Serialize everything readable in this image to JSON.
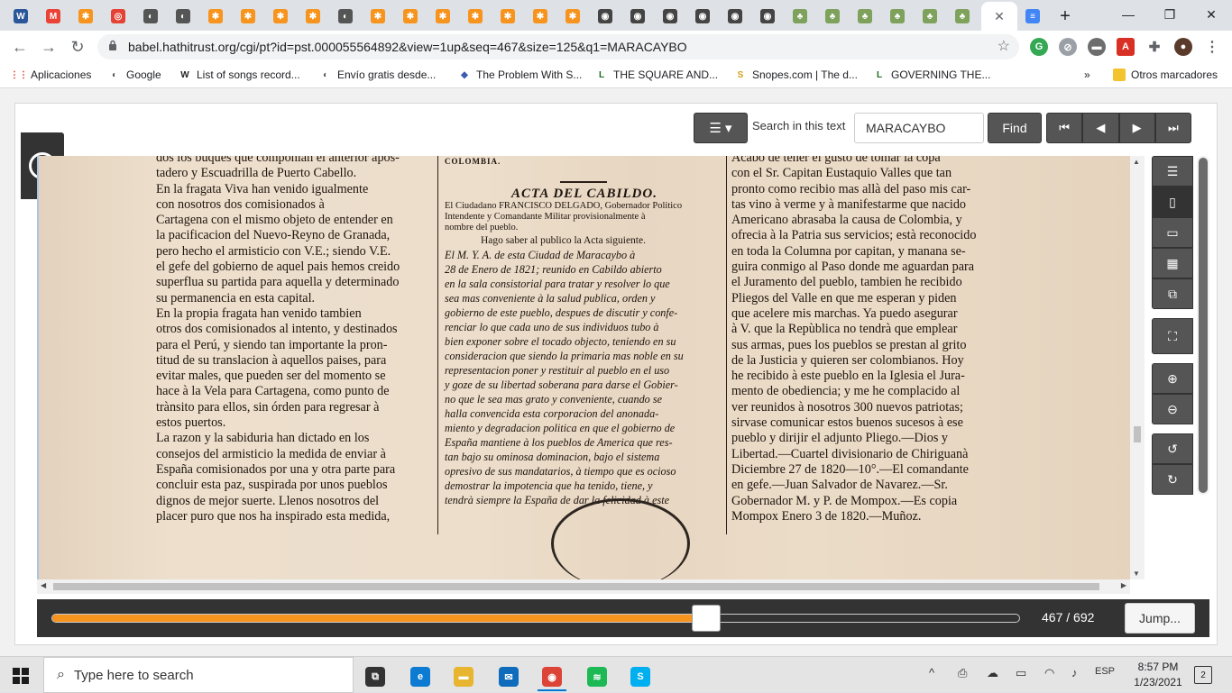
{
  "browser": {
    "tabs": [
      {
        "icon": "word-icon",
        "color": "#2b579a",
        "glyph": "W"
      },
      {
        "icon": "gmail-icon",
        "color": "#ea4335",
        "glyph": "M"
      },
      {
        "icon": "hathitrust-icon",
        "color": "#f7941d",
        "glyph": "✱"
      },
      {
        "icon": "target-icon",
        "color": "#e34234",
        "glyph": "◎"
      },
      {
        "icon": "circle-icon",
        "color": "#555555",
        "glyph": "◐"
      },
      {
        "icon": "circle-icon",
        "color": "#555555",
        "glyph": "◐"
      },
      {
        "icon": "hathitrust-icon",
        "color": "#f7941d",
        "glyph": "✱"
      },
      {
        "icon": "hathitrust-icon",
        "color": "#f7941d",
        "glyph": "✱"
      },
      {
        "icon": "hathitrust-icon",
        "color": "#f7941d",
        "glyph": "✱"
      },
      {
        "icon": "hathitrust-icon",
        "color": "#f7941d",
        "glyph": "✱"
      },
      {
        "icon": "circle-icon",
        "color": "#555555",
        "glyph": "◐"
      },
      {
        "icon": "hathitrust-icon",
        "color": "#f7941d",
        "glyph": "✱"
      },
      {
        "icon": "hathitrust-icon",
        "color": "#f7941d",
        "glyph": "✱"
      },
      {
        "icon": "hathitrust-icon",
        "color": "#f7941d",
        "glyph": "✱"
      },
      {
        "icon": "hathitrust-icon",
        "color": "#f7941d",
        "glyph": "✱"
      },
      {
        "icon": "hathitrust-icon",
        "color": "#f7941d",
        "glyph": "✱"
      },
      {
        "icon": "hathitrust-icon",
        "color": "#f7941d",
        "glyph": "✱"
      },
      {
        "icon": "hathitrust-icon",
        "color": "#f7941d",
        "glyph": "✱"
      },
      {
        "icon": "seal-icon",
        "color": "#444444",
        "glyph": "◉"
      },
      {
        "icon": "seal-icon",
        "color": "#444444",
        "glyph": "◉"
      },
      {
        "icon": "seal-icon",
        "color": "#444444",
        "glyph": "◉"
      },
      {
        "icon": "seal-icon",
        "color": "#444444",
        "glyph": "◉"
      },
      {
        "icon": "seal-icon",
        "color": "#444444",
        "glyph": "◉"
      },
      {
        "icon": "seal-icon",
        "color": "#444444",
        "glyph": "◉"
      },
      {
        "icon": "tree-icon",
        "color": "#7ea25b",
        "glyph": "♣"
      },
      {
        "icon": "tree-icon",
        "color": "#7ea25b",
        "glyph": "♣"
      },
      {
        "icon": "tree-icon",
        "color": "#7ea25b",
        "glyph": "♣"
      },
      {
        "icon": "tree-icon",
        "color": "#7ea25b",
        "glyph": "♣"
      },
      {
        "icon": "tree-icon",
        "color": "#7ea25b",
        "glyph": "♣"
      },
      {
        "icon": "tree-icon",
        "color": "#7ea25b",
        "glyph": "♣"
      }
    ],
    "active_tab_close": "✕",
    "new_tab": "+",
    "window_controls": {
      "minimize": "—",
      "maximize": "❐",
      "close": "✕"
    },
    "url": "babel.hathitrust.org/cgi/pt?id=pst.000055564892&view=1up&seq=467&size=125&q1=MARACAYBO",
    "bookmarks": [
      {
        "label": "Aplicaciones",
        "icon": "apps-grid-icon",
        "glyph": "⋮⋮",
        "color": "#d93025"
      },
      {
        "label": "Google",
        "icon": "globe-icon",
        "glyph": "◐",
        "color": "#555555"
      },
      {
        "label": "List of songs record...",
        "icon": "wikipedia-icon",
        "glyph": "W",
        "color": "#222222"
      },
      {
        "label": "Envío gratis desde...",
        "icon": "globe-icon",
        "glyph": "◐",
        "color": "#555555"
      },
      {
        "label": "The Problem With S...",
        "icon": "shield-icon",
        "glyph": "◆",
        "color": "#3b5bb5"
      },
      {
        "label": "THE SQUARE AND...",
        "icon": "book-icon",
        "glyph": "L",
        "color": "#1e6b1e"
      },
      {
        "label": "Snopes.com | The d...",
        "icon": "snopes-icon",
        "glyph": "S",
        "color": "#d4a017"
      },
      {
        "label": "GOVERNING THE...",
        "icon": "book-icon",
        "glyph": "L",
        "color": "#1e6b1e"
      }
    ],
    "bookmarks_more": "»",
    "other_bookmarks": "Otros marcadores"
  },
  "reader": {
    "view_menu_icon": "☰ ▾",
    "search_label": "Search in this text",
    "search_value": "MARACAYBO",
    "find_label": "Find",
    "pager": [
      "⏮",
      "◀",
      "▶",
      "⏭"
    ],
    "side_toggle": "›",
    "toolrail": {
      "group1": [
        "☰",
        "▯",
        "▭",
        "▦",
        "⧉"
      ],
      "fullscreen": "⛶",
      "zoom": [
        "⊕",
        "⊖"
      ],
      "rotate": [
        "↺",
        "↻"
      ]
    },
    "progress_fraction": 0.676,
    "page_current": "467",
    "page_total": "692",
    "page_sep": " / ",
    "jump_label": "Jump..."
  },
  "scan": {
    "col1": [
      "dos los buques que componian el anterior apos-",
      "tadero y Escuadrilla de Puerto Cabello.",
      "  En la fragata Viva han venido igualmente",
      "con nosotros dos comisionados à",
      "Cartagena con el mismo objeto de entender en",
      "la pacificacion del Nuevo-Reyno de Granada,",
      "pero hecho el armisticio con V.E.; siendo V.E.",
      "el gefe del gobierno de aquel pais hemos creido",
      "superflua su partida para aquella y determinado",
      "su permanencia en esta capital.",
      "  En la propia fragata han venido tambien",
      "otros dos comisionados al intento, y destinados",
      "para el Perú, y siendo tan importante la pron-",
      "titud de su translacion à aquellos paises, para",
      "evitar males, que pueden ser del momento se",
      "hace à la Vela para Cartagena, como punto de",
      "trànsito para ellos, sin órden para regresar à",
      "estos puertos.",
      "  La razon y la sabiduria han dictado en los",
      "consejos del armisticio la medida de enviar à",
      "España comisionados por una y otra parte para",
      "concluir esta paz, suspirada por unos pueblos",
      "dignos de mejor suerte. Llenos nosotros del",
      "placer puro que nos ha inspirado esta medida,"
    ],
    "col2_header": "COLOMBIA.",
    "col2_title": "ACTA DEL CABILDO.",
    "col2_intro": [
      "El Ciudadano FRANCISCO DELGADO, Gobernador Politico",
      "Intendente y Comandante Militar provisionalmente à",
      "nombre del pueblo."
    ],
    "col2_notice": "Hago saber al publico la Acta siguiente.",
    "col2": [
      "  El M. Y. A. de esta Ciudad de Maracaybo à",
      "28 de Enero de 1821; reunido en Cabildo abierto",
      "en la sala consistorial para tratar y resolver lo que",
      "sea mas conveniente à la salud publica, orden y",
      "gobierno de este pueblo, despues de discutir y confe-",
      "renciar lo que cada uno de sus individuos tubo à",
      "bien exponer sobre el tocado objecto, teniendo en su",
      "consideracion que siendo la primaria mas noble en su",
      "representacion poner y restituir al pueblo en el uso",
      "y goze de su libertad soberana para darse el Gobier-",
      "no que le sea mas grato y conveniente, cuando se",
      "halla convencida esta corporacion del anonada-",
      "miento y degradacion politica en que el gobierno de",
      "España mantiene à los pueblos de America que res-",
      "tan bajo su ominosa dominacion, bajo el sistema",
      "opresivo de sus mandatarios, à tiempo que es ocioso",
      "demostrar la impotencia que ha tenido, tiene, y",
      "tendrà siempre la España de dar la felicidad à este"
    ],
    "col3": [
      "Acabo de tener el gusto de tomar la copa",
      "con el Sr. Capitan Eustaquio Valles que tan",
      "pronto como recibio mas allà del paso mis car-",
      "tas vino à verme y à manifestarme que nacido",
      "Americano abrasaba la causa de Colombia, y",
      "ofrecia à la Patria sus servicios; està reconocido",
      "en toda la Columna por capitan, y manana se-",
      "guira conmigo al Paso donde me aguardan para",
      "el Juramento del pueblo, tambien he recibido",
      "Pliegos del Valle en que me esperan y piden",
      "que acelere mis marchas. Ya puedo asegurar",
      "à V. que la Repùblica no tendrà que emplear",
      "sus armas, pues los pueblos se prestan al grito",
      "de la Justicia y quieren ser colombianos. Hoy",
      "he recibido à este pueblo en la Iglesia el Jura-",
      "mento de obediencia; y me he complacido al",
      "ver reunidos à nosotros 300 nuevos patriotas;",
      "sirvase comunicar estos buenos sucesos à ese",
      "pueblo y dirijir el adjunto Pliego.—Dios y",
      "Libertad.—Cuartel divisionario de Chiriguanà",
      "Diciembre 27 de 1820—10°.—El comandante",
      "en gefe.—Juan Salvador de Navarez.—Sr.",
      "Gobernador M. y P. de Mompox.—Es copia",
      "Mompox Enero 3 de 1820.—Muñoz."
    ]
  },
  "taskbar": {
    "search_placeholder": "Type here to search",
    "apps": [
      {
        "icon": "task-view-icon",
        "glyph": "⧉",
        "color": "#333333"
      },
      {
        "icon": "edge-icon",
        "glyph": "e",
        "color": "#0c7bd1"
      },
      {
        "icon": "file-explorer-icon",
        "glyph": "▬",
        "color": "#e8b530"
      },
      {
        "icon": "mail-icon",
        "glyph": "✉",
        "color": "#0f6cbd"
      },
      {
        "icon": "chrome-icon",
        "glyph": "◉",
        "color": "#db4437"
      },
      {
        "icon": "spotify-icon",
        "glyph": "≋",
        "color": "#1db954"
      },
      {
        "icon": "skype-icon",
        "glyph": "S",
        "color": "#00aff0"
      }
    ],
    "tray_icons": [
      "^",
      "⎙",
      "☁",
      "▭",
      "◠",
      "♪"
    ],
    "language": "ESP",
    "time": "8:57 PM",
    "date": "1/23/2021",
    "notifications": "2"
  }
}
